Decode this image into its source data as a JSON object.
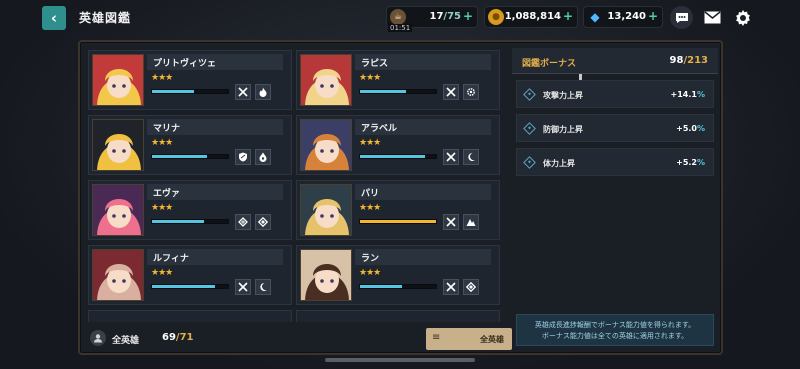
{
  "header": {
    "back_icon": "chevron-left-icon",
    "title": "英雄図鑑"
  },
  "resources": {
    "stamina": {
      "icon": "coffee-cup-icon",
      "value": "17",
      "max": "/75",
      "timer": "01:51",
      "add": "+"
    },
    "gold": {
      "icon": "gold-coin-icon",
      "value": "1,088,814",
      "add": "+"
    },
    "gems": {
      "icon": "blue-gem-icon",
      "value": "13,240",
      "add": "+"
    }
  },
  "top_icons": [
    "chat-icon",
    "mail-icon",
    "settings-gear-icon"
  ],
  "heroes": [
    {
      "name": "プリトヴィツェ",
      "stars": "★★★",
      "progress": 0.55,
      "badges": [
        "crossed-swords-icon",
        "fire-icon"
      ],
      "colors": [
        "#f3c84a",
        "#c23a3a"
      ]
    },
    {
      "name": "ラピス",
      "stars": "★★★",
      "progress": 0.6,
      "badges": [
        "crossed-swords-icon",
        "gear-icon"
      ],
      "colors": [
        "#f1d48a",
        "#b73838"
      ]
    },
    {
      "name": "マリナ",
      "stars": "★★★",
      "progress": 0.72,
      "badges": [
        "shield-icon",
        "water-drop-icon"
      ],
      "colors": [
        "#f0c040",
        "#20242a"
      ]
    },
    {
      "name": "アラベル",
      "stars": "★★★",
      "progress": 0.85,
      "badges": [
        "crossed-swords-icon",
        "moon-icon"
      ],
      "colors": [
        "#d7823a",
        "#3b3f66"
      ]
    },
    {
      "name": "エヴァ",
      "stars": "★★★",
      "progress": 0.68,
      "badges": [
        "wing-icon",
        "diamond-icon"
      ],
      "colors": [
        "#ef6f8f",
        "#4a2a55"
      ]
    },
    {
      "name": "パリ",
      "stars": "★★★",
      "progress": 1.0,
      "gold": true,
      "badges": [
        "crossed-swords-icon",
        "mountain-icon"
      ],
      "colors": [
        "#e6c36a",
        "#2f3f4a"
      ]
    },
    {
      "name": "ルフィナ",
      "stars": "★★★",
      "progress": 0.83,
      "badges": [
        "crossed-swords-icon",
        "moon-icon"
      ],
      "colors": [
        "#d9b0a0",
        "#7a2a30"
      ]
    },
    {
      "name": "ラン",
      "stars": "★★★",
      "progress": 0.55,
      "badges": [
        "crossed-swords-icon",
        "diamond-icon"
      ],
      "colors": [
        "#4a2e22",
        "#d7c2a8"
      ]
    }
  ],
  "list_footer": {
    "label": "全英雄",
    "count": "69",
    "max": "/71",
    "filter_label": "全英雄",
    "filter_icon": "menu-lines-icon"
  },
  "bonus": {
    "title": "図鑑ボーナス",
    "count": "98",
    "max": "/213",
    "stats": [
      {
        "label": "攻撃力上昇",
        "value": "+14.1",
        "unit": "%"
      },
      {
        "label": "防御力上昇",
        "value": "+5.0",
        "unit": "%"
      },
      {
        "label": "体力上昇",
        "value": "+5.2",
        "unit": "%"
      }
    ],
    "note_line1": "英雄成長進捗報酬でボーナス能力値を得られます。",
    "note_line2": "ボーナス能力値は全ての英雄に適用されます。"
  }
}
